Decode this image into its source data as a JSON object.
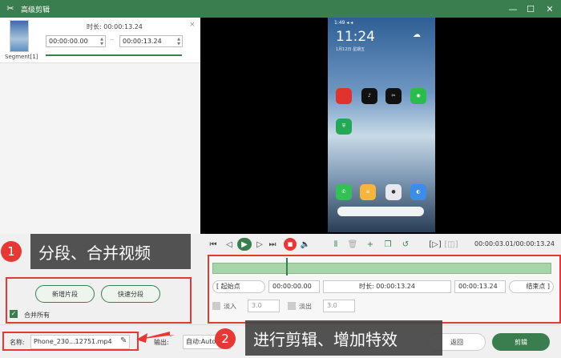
{
  "window": {
    "title": "高级剪辑"
  },
  "segment": {
    "label": "Segment[1]",
    "duration_label": "时长: 00:00:13.24",
    "start": "00:00:00.00",
    "end": "00:00:13.24",
    "sep": "--",
    "close": "×"
  },
  "phone": {
    "status": "1:49 ◂ ◂",
    "time": "11:24",
    "date": "1月12日 星期五",
    "weather": "☁"
  },
  "controls": {
    "timecode": "00:00:03.01/00:00:13.24"
  },
  "editor": {
    "start_btn": "[ 起始点",
    "start_val": "00:00:00.00",
    "duration": "时长: 00:00:13.24",
    "end_val": "00:00:13.24",
    "end_btn": "结束点 ]",
    "fade_in_label": "淡入",
    "fade_in_val": "3.0",
    "fade_out_label": "淡出",
    "fade_out_val": "3.0"
  },
  "leftctl": {
    "new_segment": "新增片段",
    "quick_segment": "快速分段",
    "merge_all": "合并所有"
  },
  "bottom": {
    "name_label": "名称:",
    "name_value": "Phone_230...12751.mp4",
    "output_label": "输出:",
    "output_value": "自动:Auto",
    "back": "返回",
    "cut": "剪辑"
  },
  "callouts": {
    "one_num": "1",
    "one_text": "分段、合并视频",
    "two_num": "2",
    "two_text": "进行剪辑、增加特效"
  },
  "colors": {
    "accent": "#3a7d4f",
    "callout_red": "#e53935"
  }
}
